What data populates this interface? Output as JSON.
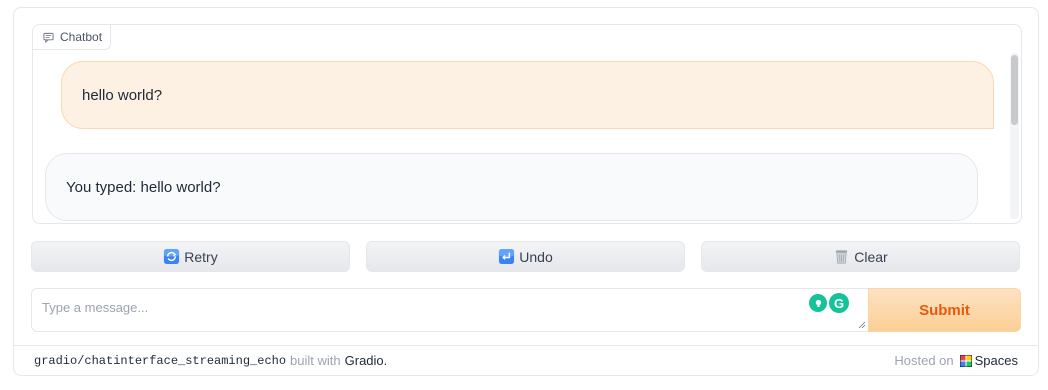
{
  "chatbot": {
    "label": "Chatbot",
    "messages": {
      "user": "hello world?",
      "bot": "You typed: hello world?"
    }
  },
  "buttons": {
    "retry": "Retry",
    "undo": "Undo",
    "clear": "Clear"
  },
  "input": {
    "placeholder": "Type a message...",
    "value": ""
  },
  "submit": {
    "label": "Submit"
  },
  "footer": {
    "repo": "gradio/chatinterface_streaming_echo",
    "built_with": "built with",
    "gradio": "Gradio",
    "period": ".",
    "hosted_on": "Hosted on",
    "spaces": "Spaces"
  },
  "colors": {
    "accent": "#ea580c",
    "user_bubble": "#fdf1e3",
    "bot_bubble": "#f9fafb",
    "grammarly": "#15c39a"
  },
  "icons": [
    "chat-bubble-icon",
    "retry-icon",
    "undo-icon",
    "trash-icon",
    "grammarly-bulb-icon",
    "grammarly-g-icon",
    "spaces-icon"
  ]
}
